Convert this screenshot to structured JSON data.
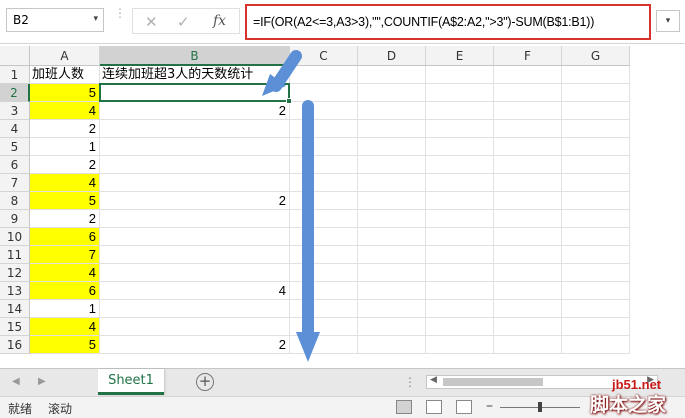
{
  "formula_bar": {
    "name_box": "B2",
    "name_box_arrow": "▾",
    "separator": "⋮",
    "cancel_glyph": "✕",
    "enter_glyph": "✓",
    "fx_glyph": "fx",
    "formula": "=IF(OR(A2<=3,A3>3),\"\",COUNTIF(A$2:A2,\">3\")-SUM(B$1:B1))",
    "expand_glyph": "▾",
    "formula_border_color": "#d9342b"
  },
  "columns": [
    "A",
    "B",
    "C",
    "D",
    "E",
    "F",
    "G"
  ],
  "selected_column": "B",
  "selected_row": "2",
  "rows": [
    {
      "row": "1",
      "a": "加班人数",
      "b": "连续加班超3人的天数统计",
      "hl": false
    },
    {
      "row": "2",
      "a": "5",
      "b": "",
      "hl": true
    },
    {
      "row": "3",
      "a": "4",
      "b": "2",
      "hl": true
    },
    {
      "row": "4",
      "a": "2",
      "b": "",
      "hl": false
    },
    {
      "row": "5",
      "a": "1",
      "b": "",
      "hl": false
    },
    {
      "row": "6",
      "a": "2",
      "b": "",
      "hl": false
    },
    {
      "row": "7",
      "a": "4",
      "b": "",
      "hl": true
    },
    {
      "row": "8",
      "a": "5",
      "b": "2",
      "hl": true
    },
    {
      "row": "9",
      "a": "2",
      "b": "",
      "hl": false
    },
    {
      "row": "10",
      "a": "6",
      "b": "",
      "hl": true
    },
    {
      "row": "11",
      "a": "7",
      "b": "",
      "hl": true
    },
    {
      "row": "12",
      "a": "4",
      "b": "",
      "hl": true
    },
    {
      "row": "13",
      "a": "6",
      "b": "4",
      "hl": true
    },
    {
      "row": "14",
      "a": "1",
      "b": "",
      "hl": false
    },
    {
      "row": "15",
      "a": "4",
      "b": "",
      "hl": true
    },
    {
      "row": "16",
      "a": "5",
      "b": "2",
      "hl": true
    }
  ],
  "highlight_color": "#ffff00",
  "arrow_color": "#5b8fd6",
  "sheet_tabs": {
    "nav_left": "◀",
    "nav_right": "▶",
    "active": "Sheet1",
    "add_glyph": "+",
    "more_glyph": "⋮",
    "scroll_left": "◀",
    "scroll_right": "▶"
  },
  "status_bar": {
    "ready": "就绪",
    "scroll": "滚动",
    "zoom_out": "–"
  },
  "watermark": {
    "site": "jb51.net",
    "name": "脚本之家"
  },
  "accent_color": "#217346"
}
